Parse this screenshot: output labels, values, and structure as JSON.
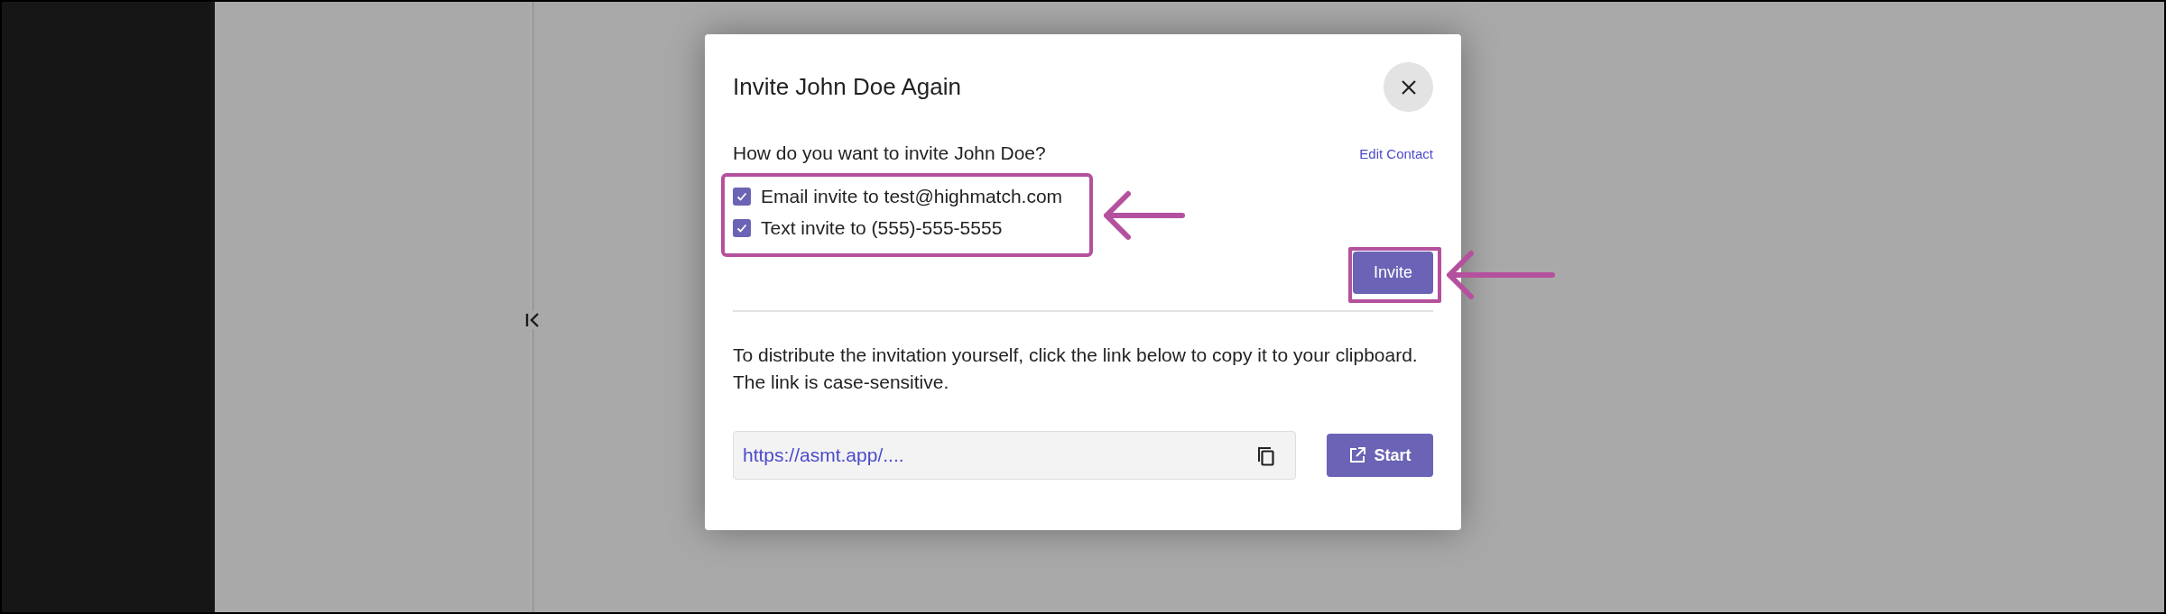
{
  "dialog": {
    "title": "Invite John Doe Again",
    "question": "How do you want to invite John Doe?",
    "edit_link": "Edit Contact",
    "options": [
      {
        "label": "Email invite to test@highmatch.com",
        "checked": true
      },
      {
        "label": "Text invite to (555)-555-5555",
        "checked": true
      }
    ],
    "invite_button": "Invite",
    "instructions": "To distribute the invitation yourself, click the link below to copy it to your clipboard. The link is case-sensitive.",
    "link_field": {
      "value": "https://asmt.app/...."
    },
    "start_button": "Start"
  }
}
